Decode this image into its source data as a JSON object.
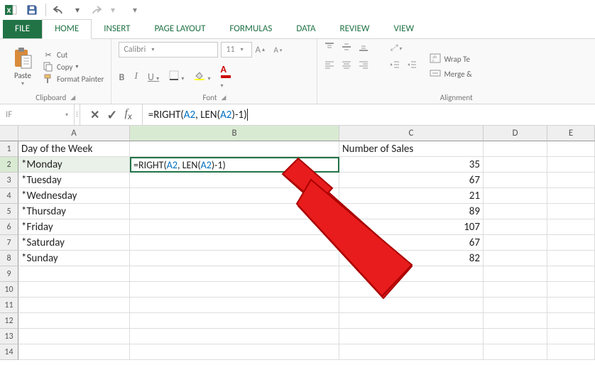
{
  "qat": {
    "save": "save-icon",
    "undo": "undo-icon",
    "redo": "redo-icon"
  },
  "tabs": {
    "file": "FILE",
    "home": "HOME",
    "insert": "INSERT",
    "page_layout": "PAGE LAYOUT",
    "formulas": "FORMULAS",
    "data": "DATA",
    "review": "REVIEW",
    "view": "VIEW"
  },
  "ribbon": {
    "clipboard": {
      "paste": "Paste",
      "cut": "Cut",
      "copy": "Copy",
      "format_painter": "Format Painter",
      "label": "Clipboard"
    },
    "font": {
      "name": "Calibri",
      "size": "11",
      "bold": "B",
      "italic": "I",
      "underline": "U",
      "label": "Font"
    },
    "alignment": {
      "wrap": "Wrap Te",
      "merge": "Merge &",
      "label": "Alignment"
    }
  },
  "formula_bar": {
    "name_box": "IF",
    "formula_prefix": "=RIGHT(",
    "formula_ref1": "A2",
    "formula_mid": ", LEN(",
    "formula_ref2": "A2",
    "formula_suffix": ")-1)"
  },
  "grid": {
    "columns": [
      "A",
      "B",
      "C",
      "D",
      "E"
    ],
    "rows": [
      {
        "n": "1",
        "a": "Day of the Week",
        "b": "",
        "c_text": "Number of Sales",
        "c_num": ""
      },
      {
        "n": "2",
        "a": "*Monday",
        "b_formula": true,
        "c_num": "35"
      },
      {
        "n": "3",
        "a": "*Tuesday",
        "b": "",
        "c_num": "67"
      },
      {
        "n": "4",
        "a": "*Wednesday",
        "b": "",
        "c_num": "21"
      },
      {
        "n": "5",
        "a": "*Thursday",
        "b": "",
        "c_num": "89"
      },
      {
        "n": "6",
        "a": "*Friday",
        "b": "",
        "c_num": "107"
      },
      {
        "n": "7",
        "a": "*Saturday",
        "b": "",
        "c_num": "67"
      },
      {
        "n": "8",
        "a": "*Sunday",
        "b": "",
        "c_num": "82"
      },
      {
        "n": "9"
      },
      {
        "n": "10"
      },
      {
        "n": "11"
      },
      {
        "n": "12"
      },
      {
        "n": "13"
      },
      {
        "n": "14"
      }
    ],
    "editing_formula": {
      "prefix": "=RIGHT(",
      "ref1": "A2",
      "mid": ", LEN(",
      "ref2": "A2",
      "suffix": ")-1)"
    }
  }
}
